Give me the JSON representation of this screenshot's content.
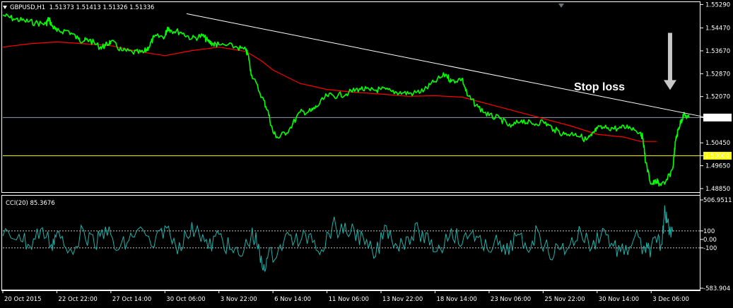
{
  "header": {
    "symbol": "GBPUSD,H1",
    "ohlc": "1.51373 1.51413 1.51326 1.51336"
  },
  "cci_header": {
    "label": "CCI(20) 85.3676"
  },
  "annotation": {
    "text": "Stop loss"
  },
  "colors": {
    "background": "#000000",
    "price": "#00ff00",
    "ma": "#ff0000",
    "trendline": "#ffffff",
    "support": "#ffff00",
    "cci": "#20b2aa",
    "current_price_line": "#8f9bb3"
  },
  "chart_data": [
    {
      "type": "line",
      "title": "GBPUSD,H1",
      "y_tick_labels": [
        "1.55290",
        "1.54470",
        "1.53670",
        "1.52870",
        "1.52070",
        "1.51336",
        "1.50450",
        "1.50000",
        "1.49650",
        "1.48850"
      ],
      "y_ticks": [
        1.5529,
        1.5447,
        1.5367,
        1.5287,
        1.5207,
        1.51336,
        1.5045,
        1.5,
        1.4965,
        1.4885
      ],
      "ylim": [
        1.4875,
        1.5535
      ],
      "x_tick_labels": [
        "20 Oct 2015",
        "22 Oct 22:00",
        "27 Oct 14:00",
        "30 Oct 06:00",
        "3 Nov 22:00",
        "6 Nov 14:00",
        "11 Nov 06:00",
        "13 Nov 22:00",
        "18 Nov 14:00",
        "23 Nov 06:00",
        "25 Nov 22:00",
        "30 Nov 14:00",
        "3 Dec 06:00"
      ],
      "x_tick_index": [
        0,
        1,
        2,
        3,
        4,
        5,
        6,
        7,
        8,
        9,
        10,
        11,
        12
      ],
      "xlim": [
        0,
        12.9
      ],
      "series": [
        {
          "kind": "price",
          "x": [
            0,
            0.2,
            0.4,
            0.6,
            0.8,
            0.85,
            0.9,
            1.0,
            1.2,
            1.4,
            1.5,
            1.6,
            1.8,
            1.9,
            2.0,
            2.2,
            2.4,
            2.6,
            2.7,
            2.8,
            3.0,
            3.05,
            3.1,
            3.3,
            3.5,
            3.7,
            3.8,
            3.9,
            4.0,
            4.3,
            4.5,
            4.55,
            4.6,
            4.8,
            4.9,
            5.0,
            5.1,
            5.3,
            5.5,
            5.7,
            5.8,
            6.0,
            6.2,
            6.4,
            6.6,
            6.8,
            7.0,
            7.2,
            7.4,
            7.6,
            7.8,
            8.0,
            8.2,
            8.3,
            8.5,
            8.6,
            8.8,
            9.0,
            9.2,
            9.4,
            9.6,
            9.8,
            10.0,
            10.2,
            10.4,
            10.6,
            10.8,
            10.9,
            11.0,
            11.2,
            11.4,
            11.6,
            11.8,
            11.85,
            11.9,
            12.0,
            12.1,
            12.15,
            12.25,
            12.4,
            12.45,
            12.5,
            12.55,
            12.6,
            12.7
          ],
          "values": [
            1.5492,
            1.5479,
            1.5472,
            1.5465,
            1.5461,
            1.548,
            1.5458,
            1.5435,
            1.5438,
            1.5408,
            1.5402,
            1.5405,
            1.538,
            1.5385,
            1.54,
            1.5368,
            1.5362,
            1.536,
            1.538,
            1.5415,
            1.5418,
            1.545,
            1.544,
            1.5432,
            1.541,
            1.542,
            1.54,
            1.5391,
            1.5388,
            1.5382,
            1.5368,
            1.5346,
            1.5285,
            1.5205,
            1.516,
            1.5082,
            1.5062,
            1.5092,
            1.5152,
            1.5155,
            1.517,
            1.521,
            1.521,
            1.522,
            1.5235,
            1.5228,
            1.5232,
            1.5225,
            1.522,
            1.5218,
            1.523,
            1.526,
            1.5285,
            1.526,
            1.527,
            1.521,
            1.517,
            1.514,
            1.513,
            1.51,
            1.5125,
            1.511,
            1.512,
            1.5092,
            1.5075,
            1.5078,
            1.5055,
            1.507,
            1.5095,
            1.5098,
            1.5095,
            1.5102,
            1.5082,
            1.506,
            1.4975,
            1.49,
            1.491,
            1.4902,
            1.49,
            1.4955,
            1.505,
            1.509,
            1.512,
            1.5142,
            1.5134
          ]
        },
        {
          "kind": "ma",
          "x": [
            0,
            0.5,
            1,
            1.5,
            2,
            2.5,
            3,
            3.5,
            4,
            4.5,
            4.8,
            5,
            5.5,
            6,
            6.5,
            7,
            7.5,
            8,
            8.5,
            9,
            9.5,
            10,
            10.5,
            11,
            11.5,
            11.8,
            12.1
          ],
          "values": [
            1.538,
            1.5392,
            1.5398,
            1.5392,
            1.5385,
            1.5365,
            1.535,
            1.5368,
            1.538,
            1.5365,
            1.533,
            1.53,
            1.5253,
            1.5232,
            1.5222,
            1.5216,
            1.5208,
            1.521,
            1.5205,
            1.518,
            1.5155,
            1.513,
            1.5105,
            1.5075,
            1.5065,
            1.505,
            1.505
          ]
        }
      ],
      "trendline": {
        "x": [
          3.4,
          13.0
        ],
        "values": [
          1.5497,
          1.5135
        ]
      },
      "horizontal_levels": [
        {
          "name": "support",
          "value": 1.5,
          "label": "1.50000"
        },
        {
          "name": "current",
          "value": 1.51336,
          "label": "1.51336"
        }
      ],
      "annotation": {
        "text": "Stop loss",
        "arrow_x": 12.35,
        "arrow_from": 1.543,
        "arrow_to": 1.523
      }
    },
    {
      "type": "line",
      "title": "CCI(20) 85.3676",
      "y_tick_labels": [
        "506.9511",
        "100",
        "0.00",
        "-100",
        "-583.904"
      ],
      "y_ticks": [
        506.9511,
        100,
        0,
        -100,
        -583.904
      ],
      "ylim": [
        -583.904,
        506.9511
      ],
      "reference_lines": [
        100,
        -100
      ],
      "series": [
        {
          "kind": "cci",
          "x": [
            0,
            0.3,
            0.5,
            0.7,
            0.9,
            1.0,
            1.2,
            1.5,
            1.7,
            1.9,
            2.1,
            2.3,
            2.5,
            2.8,
            3.0,
            3.2,
            3.4,
            3.6,
            3.8,
            4.0,
            4.2,
            4.4,
            4.6,
            4.7,
            4.8,
            4.9,
            5.1,
            5.3,
            5.5,
            5.7,
            5.9,
            6.1,
            6.3,
            6.5,
            6.7,
            6.9,
            7.1,
            7.3,
            7.5,
            7.7,
            7.9,
            8.1,
            8.3,
            8.5,
            8.7,
            8.9,
            9.1,
            9.3,
            9.5,
            9.7,
            9.9,
            10.1,
            10.3,
            10.5,
            10.7,
            10.9,
            11.1,
            11.3,
            11.5,
            11.7,
            11.9,
            12.0,
            12.1,
            12.2,
            12.25,
            12.3,
            12.4
          ],
          "values": [
            40,
            60,
            -80,
            120,
            -60,
            80,
            -160,
            100,
            -90,
            150,
            -130,
            -40,
            120,
            -90,
            160,
            -80,
            40,
            160,
            -110,
            60,
            -120,
            -200,
            60,
            -40,
            -330,
            -220,
            -120,
            50,
            -40,
            70,
            -120,
            170,
            70,
            120,
            -60,
            -200,
            160,
            -80,
            30,
            100,
            -70,
            -110,
            130,
            -60,
            110,
            -130,
            -20,
            -180,
            40,
            -120,
            110,
            -160,
            -120,
            -60,
            90,
            -100,
            130,
            -80,
            -180,
            40,
            -160,
            -90,
            -40,
            -60,
            400,
            200,
            90
          ]
        }
      ]
    }
  ]
}
